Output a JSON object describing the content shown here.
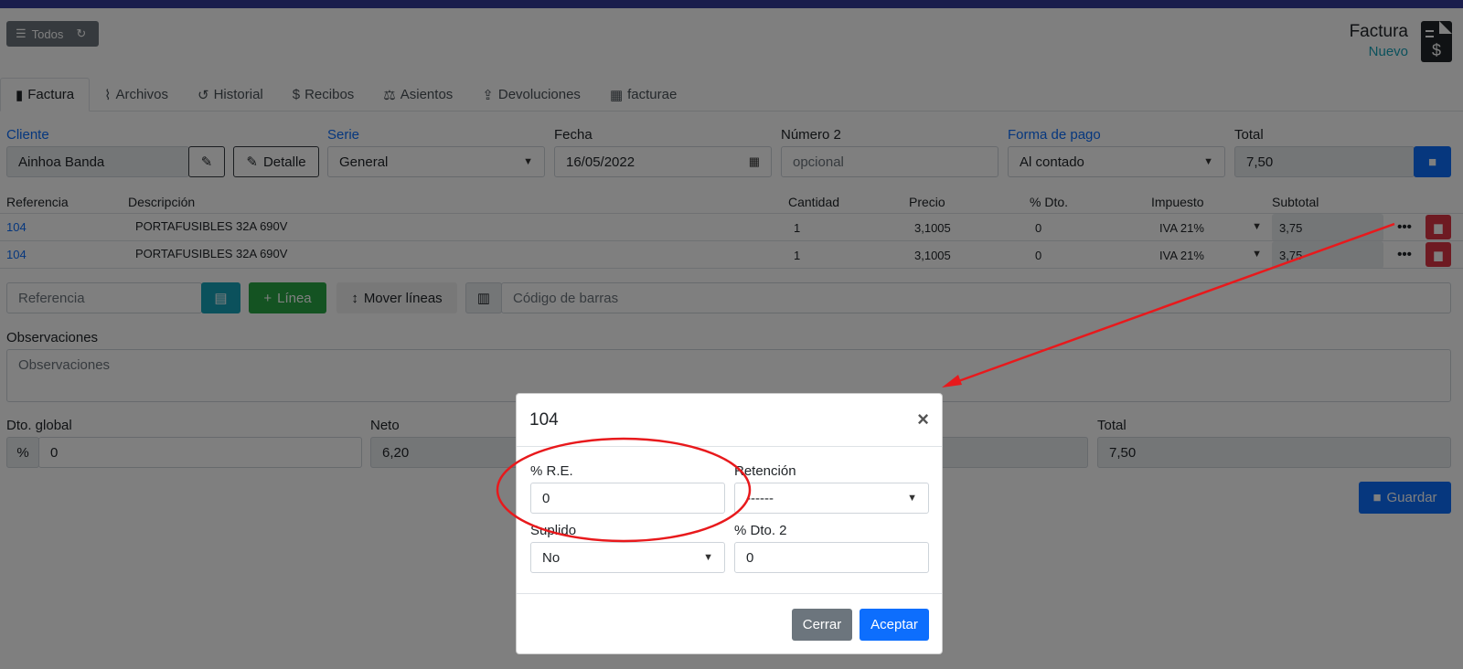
{
  "toolbar": {
    "todos_label": "Todos"
  },
  "document": {
    "title": "Factura",
    "status": "Nuevo"
  },
  "tabs": [
    {
      "label": "Factura"
    },
    {
      "label": "Archivos"
    },
    {
      "label": "Historial"
    },
    {
      "label": "Recibos"
    },
    {
      "label": "Asientos"
    },
    {
      "label": "Devoluciones"
    },
    {
      "label": "facturae"
    }
  ],
  "header": {
    "cliente_label": "Cliente",
    "cliente_value": "Ainhoa Banda",
    "detalle_label": "Detalle",
    "serie_label": "Serie",
    "serie_value": "General",
    "fecha_label": "Fecha",
    "fecha_value": "16/05/2022",
    "numero2_label": "Número 2",
    "numero2_placeholder": "opcional",
    "forma_pago_label": "Forma de pago",
    "forma_pago_value": "Al contado",
    "total_label": "Total",
    "total_value": "7,50"
  },
  "lines": {
    "columns": [
      "Referencia",
      "Descripción",
      "Cantidad",
      "Precio",
      "% Dto.",
      "Impuesto",
      "Subtotal"
    ],
    "rows": [
      {
        "ref": "104",
        "desc": "PORTAFUSIBLES 32A 690V",
        "cantidad": "1",
        "precio": "3,1005",
        "dto": "0",
        "impuesto": "IVA 21%",
        "subtotal": "3,75"
      },
      {
        "ref": "104",
        "desc": "PORTAFUSIBLES 32A 690V",
        "cantidad": "1",
        "precio": "3,1005",
        "dto": "0",
        "impuesto": "IVA 21%",
        "subtotal": "3,75"
      }
    ]
  },
  "add_line": {
    "ref_placeholder": "Referencia",
    "linea_label": "Línea",
    "mover_label": "Mover líneas",
    "barcode_placeholder": "Código de barras"
  },
  "observaciones": {
    "label": "Observaciones",
    "placeholder": "Observaciones"
  },
  "footer": {
    "dto_global_label": "Dto. global",
    "dto_global_value": "0",
    "neto_label": "Neto",
    "neto_value": "6,20",
    "total_label": "Total",
    "total_value": "7,50",
    "guardar_label": "Guardar"
  },
  "modal": {
    "title": "104",
    "re_label": "% R.E.",
    "re_value": "0",
    "retencion_label": "Retención",
    "retencion_value": "------",
    "suplido_label": "Suplido",
    "suplido_value": "No",
    "dto2_label": "% Dto. 2",
    "dto2_value": "0",
    "cerrar_label": "Cerrar",
    "aceptar_label": "Aceptar"
  },
  "colors": {
    "primary": "#0d6efd",
    "success": "#28a745",
    "info": "#17a2b8",
    "danger": "#dc3545",
    "secondary": "#6c757d",
    "annotation": "#e8191c"
  }
}
